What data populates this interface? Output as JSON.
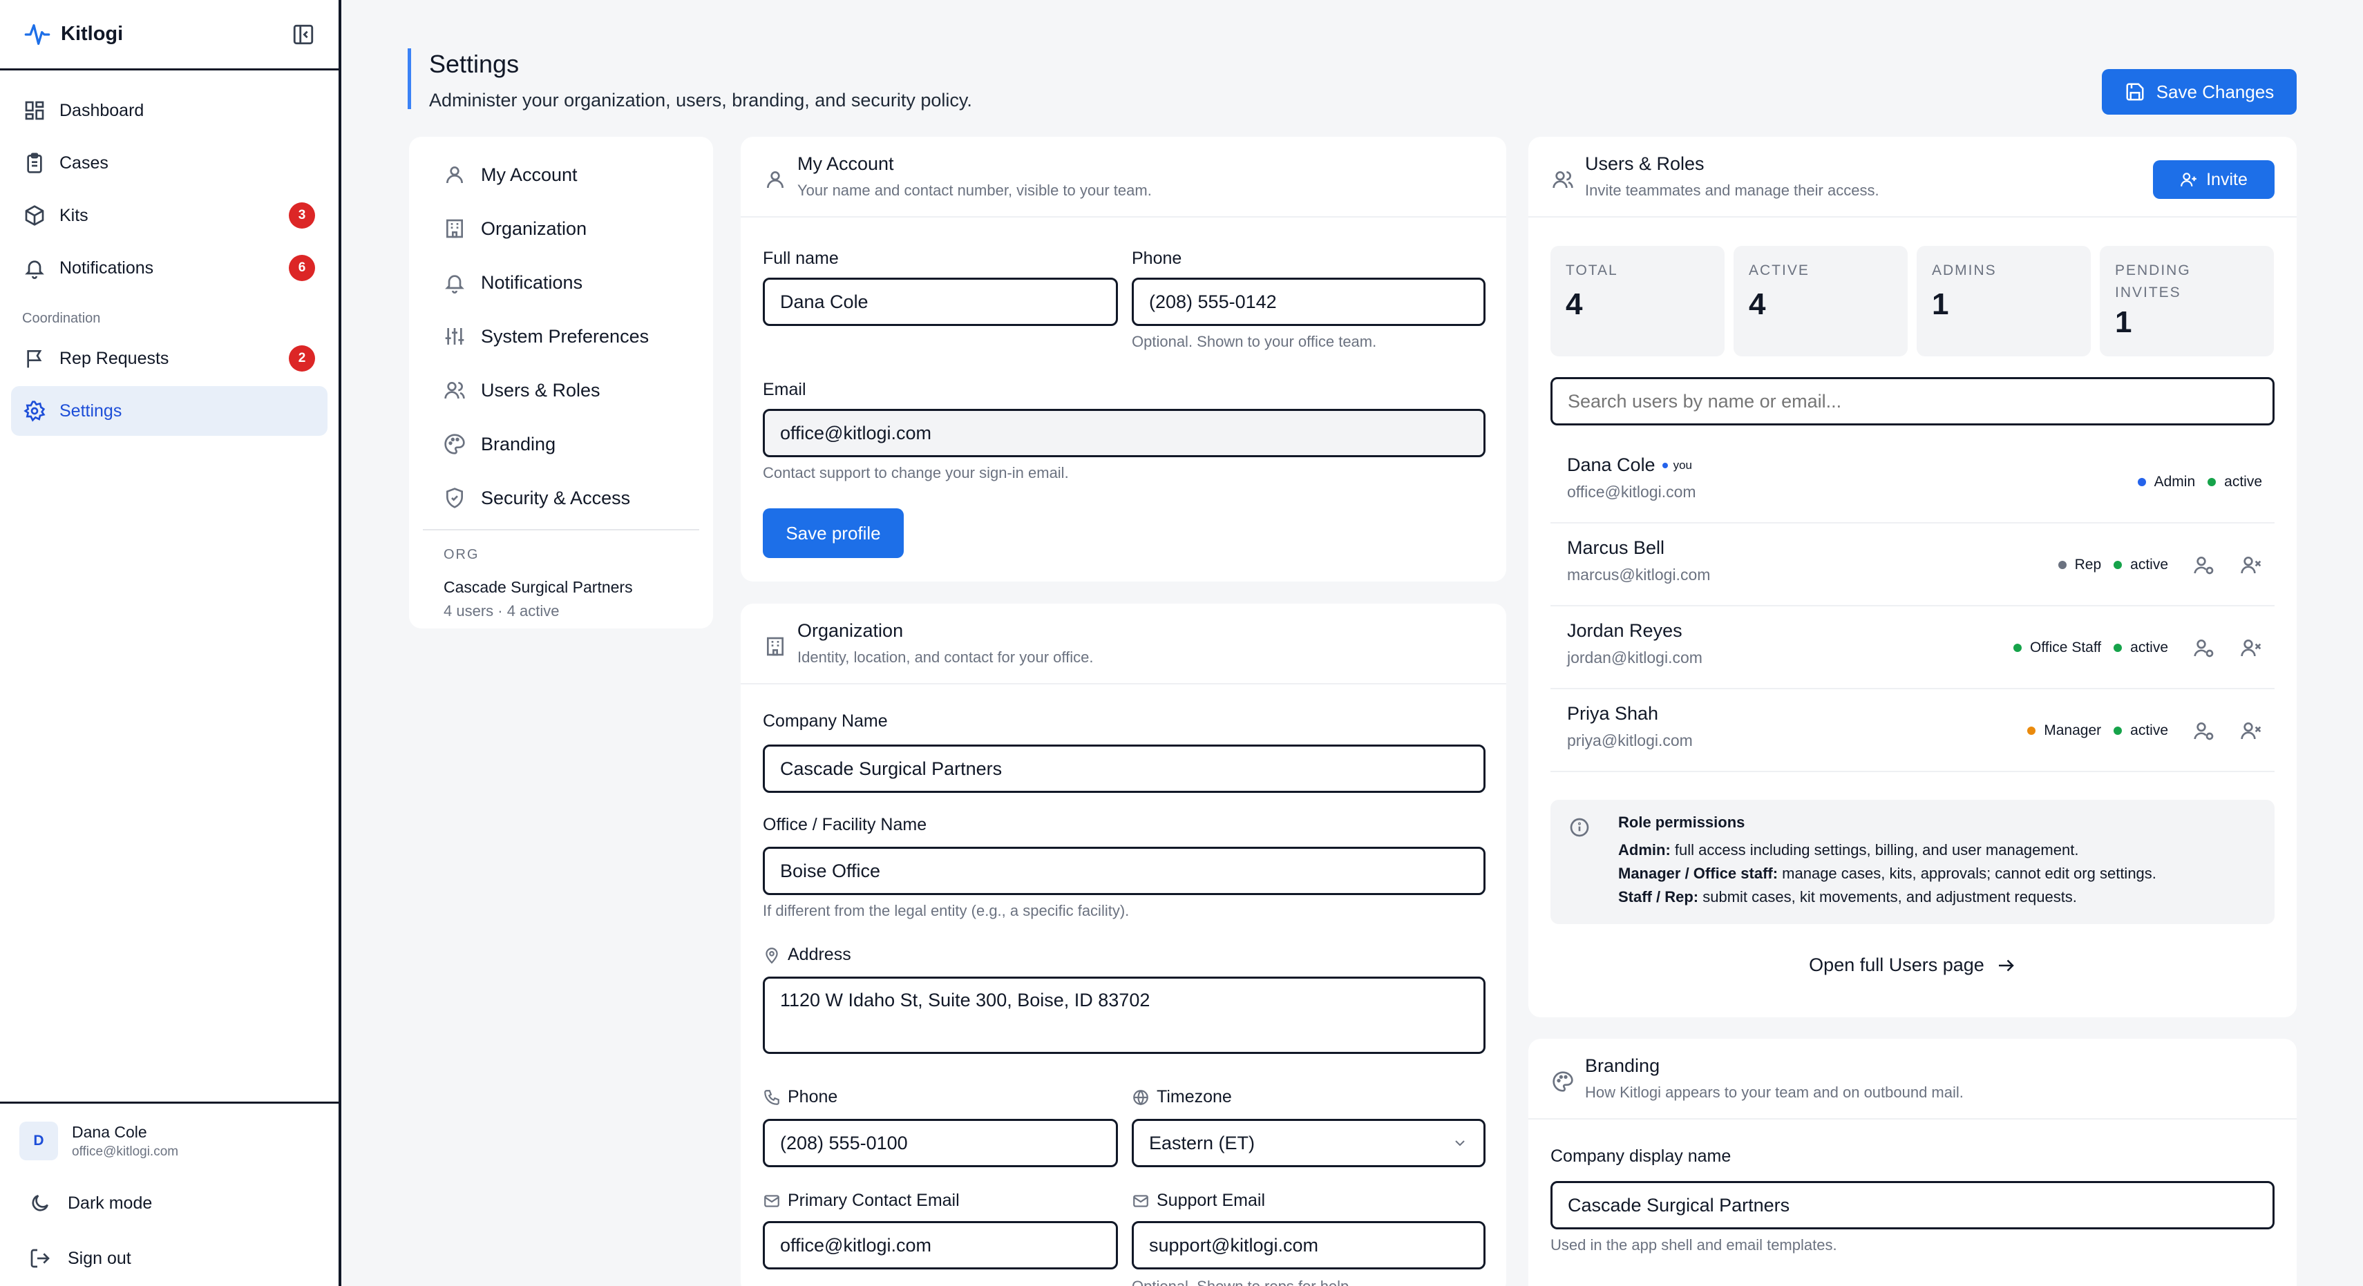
{
  "app": {
    "name": "Kitlogi"
  },
  "sidebar": {
    "items": [
      {
        "label": "Dashboard",
        "icon": "dashboard-icon"
      },
      {
        "label": "Cases",
        "icon": "clipboard-icon"
      },
      {
        "label": "Kits",
        "icon": "box-icon",
        "badge": "3"
      },
      {
        "label": "Notifications",
        "icon": "bell-icon",
        "badge": "6"
      }
    ],
    "section_label": "Coordination",
    "coord_items": [
      {
        "label": "Rep Requests",
        "icon": "flag-icon",
        "badge": "2"
      },
      {
        "label": "Settings",
        "icon": "gear-icon"
      }
    ],
    "user": {
      "initial": "D",
      "name": "Dana Cole",
      "email": "office@kitlogi.com"
    },
    "dark_mode": "Dark mode",
    "sign_out": "Sign out"
  },
  "header": {
    "title": "Settings",
    "subtitle": "Administer your organization, users, branding, and security policy.",
    "save_label": "Save Changes"
  },
  "settings_nav": {
    "items": [
      "My Account",
      "Organization",
      "Notifications",
      "System Preferences",
      "Users & Roles",
      "Branding",
      "Security & Access"
    ],
    "org_label": "ORG",
    "org_name": "Cascade Surgical Partners",
    "org_meta": "4 users · 4 active"
  },
  "my_account": {
    "title": "My Account",
    "subtitle": "Your name and contact number, visible to your team.",
    "full_name_label": "Full name",
    "full_name": "Dana Cole",
    "phone_label": "Phone",
    "phone": "(208) 555-0142",
    "phone_help": "Optional. Shown to your office team.",
    "email_label": "Email",
    "email": "office@kitlogi.com",
    "email_help": "Contact support to change your sign-in email.",
    "save_label": "Save profile"
  },
  "organization": {
    "title": "Organization",
    "subtitle": "Identity, location, and contact for your office.",
    "company_label": "Company Name",
    "company": "Cascade Surgical Partners",
    "facility_label": "Office / Facility Name",
    "facility": "Boise Office",
    "facility_help": "If different from the legal entity (e.g., a specific facility).",
    "address_label": "Address",
    "address": "1120 W Idaho St, Suite 300, Boise, ID 83702",
    "phone_label": "Phone",
    "phone": "(208) 555-0100",
    "timezone_label": "Timezone",
    "timezone": "Eastern (ET)",
    "primary_email_label": "Primary Contact Email",
    "primary_email": "office@kitlogi.com",
    "support_email_label": "Support Email",
    "support_email": "support@kitlogi.com",
    "support_help": "Optional. Shown to reps for help."
  },
  "users_roles": {
    "title": "Users & Roles",
    "subtitle": "Invite teammates and manage their access.",
    "invite_label": "Invite",
    "stats": [
      {
        "label": "TOTAL",
        "value": "4"
      },
      {
        "label": "ACTIVE",
        "value": "4"
      },
      {
        "label": "ADMINS",
        "value": "1"
      },
      {
        "label": "PENDING INVITES",
        "value": "1"
      }
    ],
    "search_placeholder": "Search users by name or email...",
    "users": [
      {
        "name": "Dana Cole",
        "you": "you",
        "email": "office@kitlogi.com",
        "role": "Admin",
        "role_color": "#2563eb",
        "status": "active",
        "actions": false
      },
      {
        "name": "Marcus Bell",
        "email": "marcus@kitlogi.com",
        "role": "Rep",
        "role_color": "#6b7280",
        "status": "active",
        "actions": true
      },
      {
        "name": "Jordan Reyes",
        "email": "jordan@kitlogi.com",
        "role": "Office Staff",
        "role_color": "#16a34a",
        "status": "active",
        "actions": true
      },
      {
        "name": "Priya Shah",
        "email": "priya@kitlogi.com",
        "role": "Manager",
        "role_color": "#ea8a0c",
        "status": "active",
        "actions": true
      }
    ],
    "status_color": "#16a34a",
    "permissions": {
      "title": "Role permissions",
      "lines": [
        {
          "role": "Admin:",
          "text": " full access including settings, billing, and user management."
        },
        {
          "role": "Manager / Office staff:",
          "text": " manage cases, kits, approvals; cannot edit org settings."
        },
        {
          "role": "Staff / Rep:",
          "text": " submit cases, kit movements, and adjustment requests."
        }
      ]
    },
    "open_full_label": "Open full Users page"
  },
  "branding": {
    "title": "Branding",
    "subtitle": "How Kitlogi appears to your team and on outbound mail.",
    "display_name_label": "Company display name",
    "display_name": "Cascade Surgical Partners",
    "display_help": "Used in the app shell and email templates."
  },
  "colors": {
    "accent": "#1d6fe8",
    "badge": "#dc2626",
    "active_nav_bg": "#e8eff9"
  }
}
